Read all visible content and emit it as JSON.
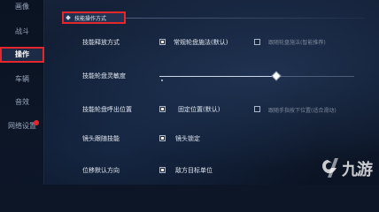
{
  "sidebar": {
    "items": [
      {
        "label": "画像"
      },
      {
        "label": "战斗"
      },
      {
        "label": "操作"
      },
      {
        "label": "车辆"
      },
      {
        "label": "音效"
      },
      {
        "label": "网络设置"
      }
    ],
    "active_index": 2
  },
  "section": {
    "title": "技能操作方式"
  },
  "settings": {
    "cast_mode": {
      "label": "技能释放方式",
      "option_a": "常规轮盘施法(默认)",
      "option_b": "跟随轮盘施法(智能推荐)"
    },
    "sensitivity": {
      "label": "技能轮盘灵敏度",
      "value": 0.6
    },
    "wheel_position": {
      "label": "技能轮盘呼出位置",
      "option_a": "固定位置(默认)",
      "option_b": "跟随手指按下位置(适合滑动)"
    },
    "camera_follow": {
      "label": "镜头跟随技能",
      "option": "镜头锁定"
    },
    "move_direction": {
      "label": "位移默认方向",
      "option": "敌方目标单位"
    }
  },
  "watermark": {
    "text": "九游"
  }
}
